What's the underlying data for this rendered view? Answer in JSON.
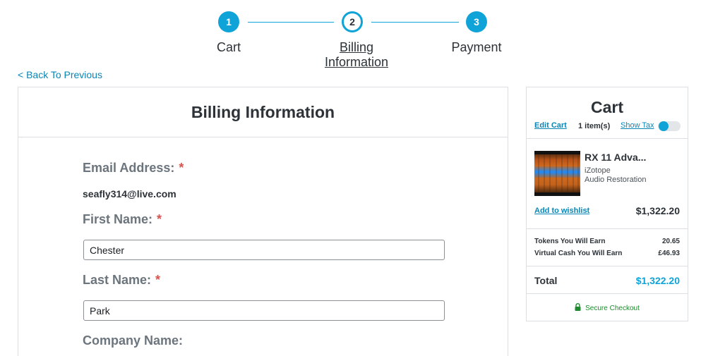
{
  "stepper": {
    "steps": [
      {
        "number": "1",
        "label": "Cart"
      },
      {
        "number": "2",
        "label_line1": "Billing",
        "label_line2": "Information"
      },
      {
        "number": "3",
        "label": "Payment"
      }
    ],
    "active_step": 2
  },
  "back_link": "< Back To Previous",
  "billing": {
    "title": "Billing Information",
    "email_label": "Email Address:",
    "email_value": "seafly314@live.com",
    "first_name_label": "First Name:",
    "first_name_value": "Chester",
    "last_name_label": "Last Name:",
    "last_name_value": "Park",
    "company_label": "Company Name:",
    "required_mark": "*"
  },
  "cart": {
    "title": "Cart",
    "edit_cart": "Edit Cart",
    "item_count": "1 item(s)",
    "show_tax": "Show Tax",
    "product": {
      "name": "RX 11 Adva...",
      "brand": "iZotope",
      "category": "Audio Restoration",
      "price": "$1,322.20"
    },
    "add_to_wishlist": "Add to wishlist",
    "tokens_label": "Tokens You Will Earn",
    "tokens_value": "20.65",
    "virtual_cash_label": "Virtual Cash You Will Earn",
    "virtual_cash_value": "£46.93",
    "total_label": "Total",
    "total_value": "$1,322.20",
    "secure_checkout": "Secure Checkout"
  },
  "colors": {
    "accent": "#0fa3d8",
    "link": "#0a86b5",
    "required": "#d9534f",
    "secure": "#1e8a2e",
    "label_gray": "#6c757d"
  }
}
